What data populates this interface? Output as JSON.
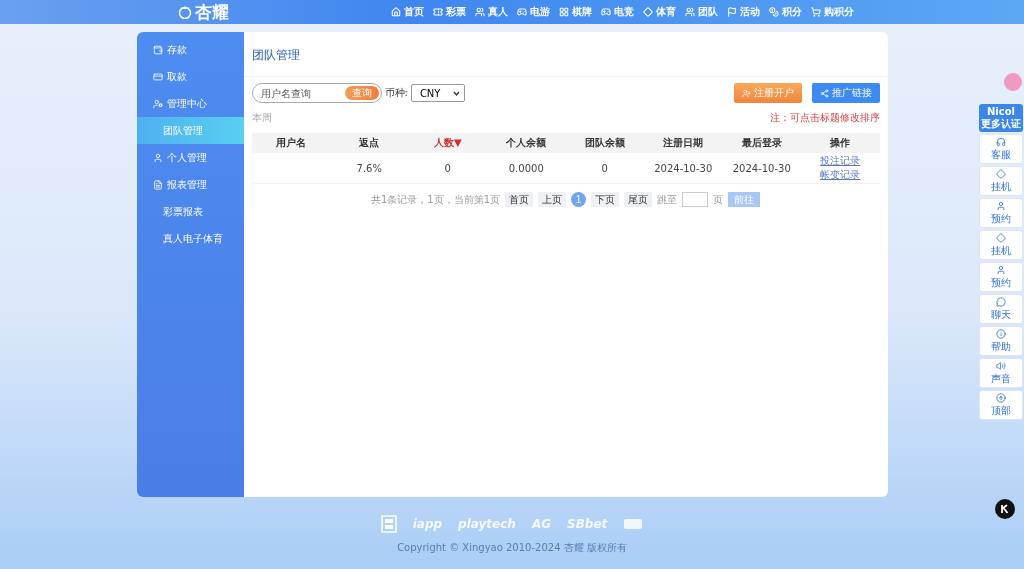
{
  "brand": "杏耀",
  "nav": [
    "首页",
    "彩票",
    "真人",
    "电游",
    "棋牌",
    "电竞",
    "体育",
    "团队",
    "活动",
    "积分",
    "购积分"
  ],
  "sidebar": [
    {
      "label": "存款",
      "kind": "main",
      "selected": false
    },
    {
      "label": "取款",
      "kind": "main",
      "selected": false
    },
    {
      "label": "管理中心",
      "kind": "main",
      "selected": false
    },
    {
      "label": "团队管理",
      "kind": "sub",
      "selected": true
    },
    {
      "label": "个人管理",
      "kind": "main",
      "selected": false
    },
    {
      "label": "报表管理",
      "kind": "main",
      "selected": false
    },
    {
      "label": "彩票报表",
      "kind": "sub",
      "selected": false
    },
    {
      "label": "真人电子体育",
      "kind": "sub",
      "selected": false
    }
  ],
  "page_title": "团队管理",
  "search": {
    "placeholder": "用户名查询",
    "button": "查询"
  },
  "currency": {
    "label": "币种:",
    "value": "CNY"
  },
  "actions": [
    {
      "label": "注册开户",
      "kind": "orange"
    },
    {
      "label": "推广链接",
      "kind": "blue"
    }
  ],
  "period": "本周",
  "note": "注：可点击标题修改排序",
  "table": {
    "columns": [
      {
        "label": "用户名",
        "sorted": false
      },
      {
        "label": "返点",
        "sorted": false
      },
      {
        "label": "人数▼",
        "sorted": true
      },
      {
        "label": "个人余额",
        "sorted": false
      },
      {
        "label": "团队余额",
        "sorted": false
      },
      {
        "label": "注册日期",
        "sorted": false
      },
      {
        "label": "最后登录",
        "sorted": false
      },
      {
        "label": "操作",
        "sorted": false
      }
    ],
    "rows": [
      {
        "cells": [
          "",
          "7.6%",
          "0",
          "0.0000",
          "0",
          "2024-10-30",
          "2024-10-30"
        ],
        "links": [
          "投注记录",
          "帐变记录"
        ]
      }
    ]
  },
  "pagination": {
    "summary": "共1条记录，1页，当前第1页",
    "buttons": [
      {
        "label": "首页",
        "selected": false
      },
      {
        "label": "上页",
        "selected": false
      },
      {
        "label": "1",
        "selected": true
      },
      {
        "label": "下页",
        "selected": false
      },
      {
        "label": "尾页",
        "selected": false
      }
    ],
    "jump_label": "跳至",
    "unit": "页",
    "go": "前往"
  },
  "float_badge": "Nicol",
  "float_badge_sub": "更多认证",
  "float_items": [
    {
      "label": "客服",
      "kind": "headset"
    },
    {
      "label": "挂机",
      "kind": "diamond"
    },
    {
      "label": "预约",
      "kind": "user"
    },
    {
      "label": "挂机",
      "kind": "diamond"
    },
    {
      "label": "预约",
      "kind": "user"
    },
    {
      "label": "聊天",
      "kind": "chat"
    },
    {
      "label": "帮助",
      "kind": "info"
    },
    {
      "label": "声音",
      "kind": "sound"
    },
    {
      "label": "顶部",
      "kind": "up"
    }
  ],
  "partners": [
    "iapp",
    "playtech",
    "AG",
    "SBbet"
  ],
  "copyright": "Copyright © Xingyao 2010-2024 杏耀 版权所有"
}
